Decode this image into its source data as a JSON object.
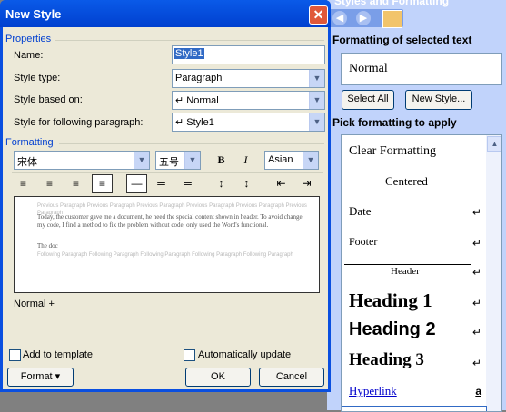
{
  "task_pane": {
    "title": "Styles and Formatting",
    "section_selected": "Formatting of selected text",
    "selected_text_format": "Normal",
    "select_all_label": "Select All",
    "new_style_label": "New Style...",
    "section_apply": "Pick formatting to apply",
    "styles": [
      {
        "label": "Clear Formatting"
      },
      {
        "label": "Centered"
      },
      {
        "label": "Date"
      },
      {
        "label": "Footer"
      },
      {
        "label": "Header"
      },
      {
        "label": "Heading 1"
      },
      {
        "label": "Heading 2"
      },
      {
        "label": "Heading 3"
      },
      {
        "label": "Hyperlink",
        "mark": "a"
      }
    ],
    "return_mark": "↵"
  },
  "dialog": {
    "title": "New Style",
    "properties_header": "Properties",
    "name_label": "Name:",
    "name_value": "Style1",
    "style_type_label": "Style type:",
    "style_type_value": "Paragraph",
    "based_on_label": "Style based on:",
    "based_on_value": "↵ Normal",
    "following_label": "Style for following paragraph:",
    "following_value": "↵ Style1",
    "formatting_header": "Formatting",
    "font_value": "宋体",
    "size_value": "五号",
    "bold_label": "B",
    "italic_label": "I",
    "script_value": "Asian",
    "preview_text": "Today, the customer gave me a document, he need the special content shown in header. To avoid change my code, I find a method to fix the problem without code, only used the Word's functional.",
    "preview_text2": "The doc",
    "description": "Normal +",
    "add_to_template_label": "Add to template",
    "auto_update_label": "Automatically update",
    "format_label": "Format ▾",
    "ok_label": "OK",
    "cancel_label": "Cancel"
  }
}
